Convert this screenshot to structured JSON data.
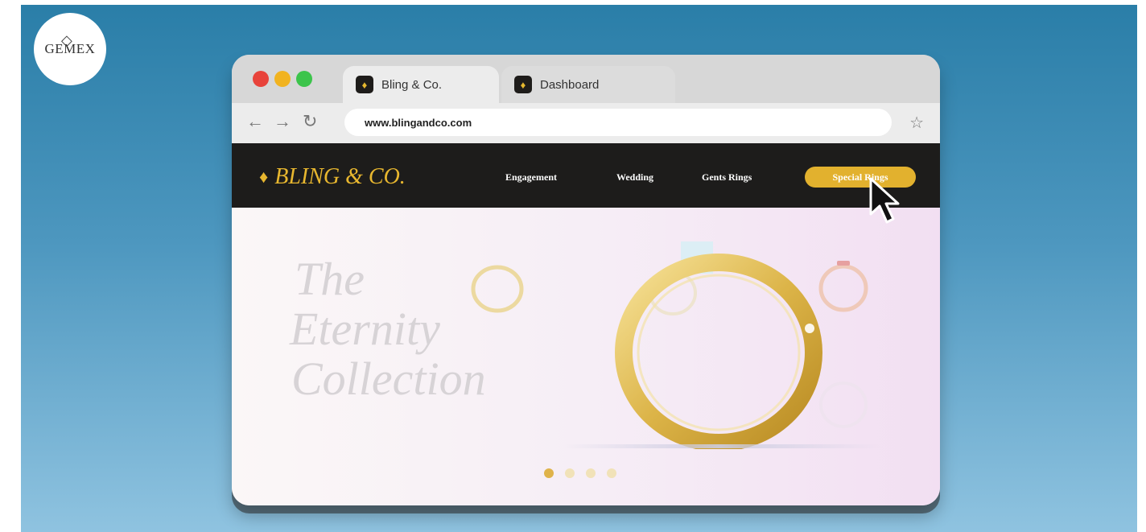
{
  "badge": {
    "logo_text": "GEMEX"
  },
  "browser": {
    "tabs": [
      {
        "label": "Bling & Co.",
        "active": true
      },
      {
        "label": "Dashboard",
        "active": false
      }
    ],
    "url": "www.blingandco.com",
    "icons": {
      "back": "back-arrow-icon",
      "forward": "forward-arrow-icon",
      "reload": "reload-icon",
      "bookmark": "star-icon"
    }
  },
  "site": {
    "brand": "BLING & CO.",
    "nav": [
      "Engagement",
      "Wedding",
      "Gents Rings"
    ],
    "cta": "Special Rings"
  },
  "hero": {
    "title_lines": [
      "The",
      "Eternity",
      "Collection"
    ],
    "carousel": {
      "total": 4,
      "active": 1
    }
  },
  "colors": {
    "gold": "#e2b12e",
    "nav_bg": "#1d1c1b",
    "bg_top": "#2a7ea8",
    "bg_bottom": "#8fc3e0"
  }
}
